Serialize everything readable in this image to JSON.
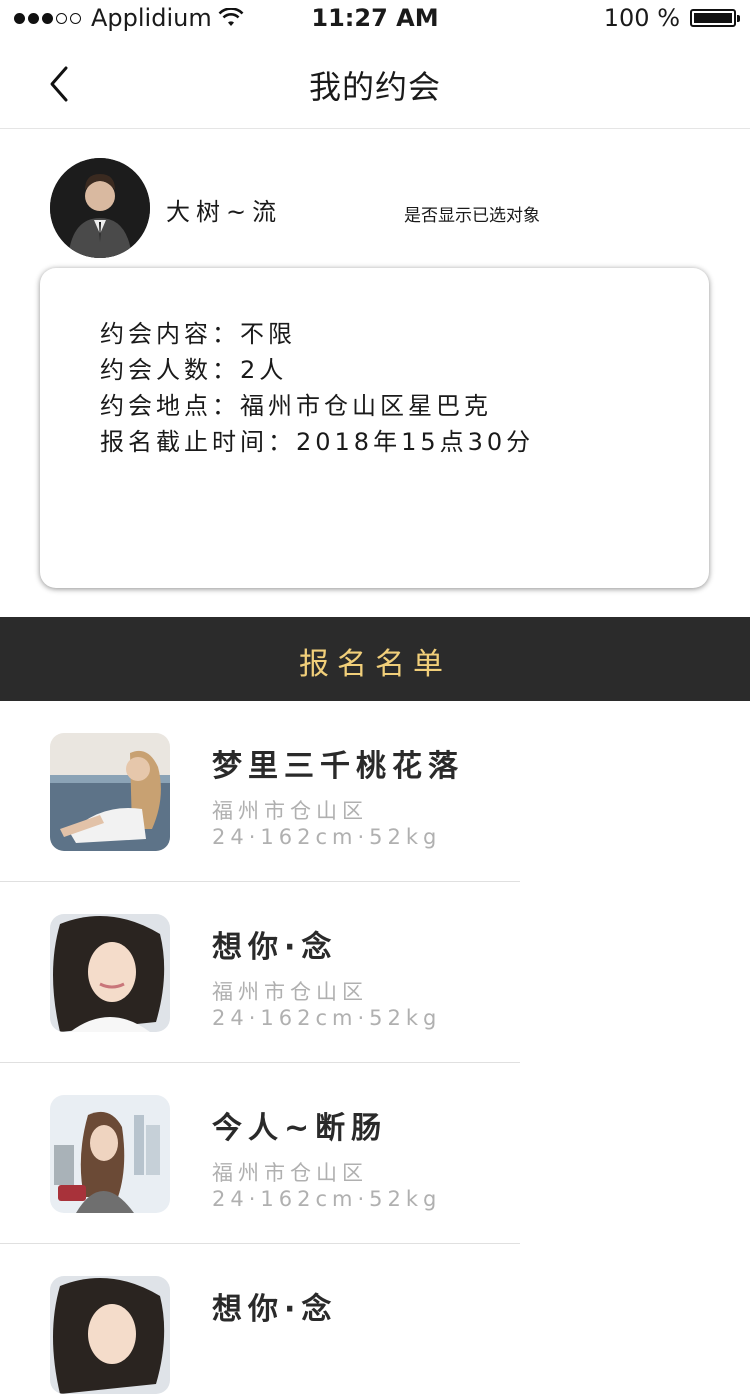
{
  "status": {
    "carrier": "Applidium",
    "time": "11:27 AM",
    "battery": "100 %"
  },
  "nav": {
    "title": "我的约会"
  },
  "host": {
    "name": "大树~流",
    "toggle_label": "是否显示已选对象"
  },
  "date": {
    "content_label": "约会内容：",
    "content_value": "不限",
    "count_label": "约会人数：",
    "count_value": "2人",
    "place_label": "约会地点：",
    "place_value": "福州市仓山区星巴克",
    "deadline_label": "报名截止时间：",
    "deadline_value": "2018年15点30分"
  },
  "section": {
    "title": "报名名单"
  },
  "applicants": [
    {
      "name": "梦里三千桃花落",
      "city": "福州市仓山区",
      "stats": "24·162cm·52kg"
    },
    {
      "name": "想你·念",
      "city": "福州市仓山区",
      "stats": "24·162cm·52kg"
    },
    {
      "name": "今人~断肠",
      "city": "福州市仓山区",
      "stats": "24·162cm·52kg"
    },
    {
      "name": "想你·念",
      "city": "",
      "stats": ""
    }
  ]
}
